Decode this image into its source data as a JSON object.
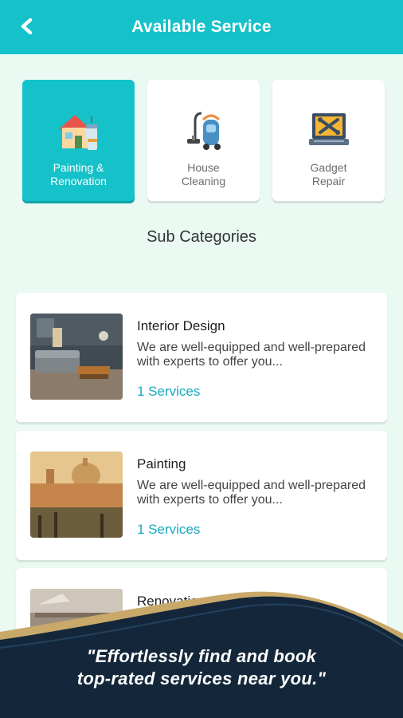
{
  "header": {
    "title": "Available Service",
    "back_icon": "chevron-left-icon"
  },
  "categories": [
    {
      "label": "Painting &\nRenovation",
      "icon": "paint-house-icon",
      "active": true
    },
    {
      "label": "House\nCleaning",
      "icon": "vacuum-cleaner-icon",
      "active": false
    },
    {
      "label": "Gadget\nRepair",
      "icon": "laptop-repair-icon",
      "active": false
    }
  ],
  "sub_categories": {
    "title": "Sub Categories",
    "items": [
      {
        "title": "Interior Design",
        "description": "We are well-equipped and well-prepared with experts to offer you...",
        "count": "1 Services"
      },
      {
        "title": "Painting",
        "description": "We are well-equipped and well-prepared with experts to offer you...",
        "count": "1 Services"
      },
      {
        "title": "Renovation",
        "description": "",
        "count": ""
      }
    ]
  },
  "promo": {
    "line1": "\"Effortlessly find and book",
    "line2": "top-rated services near you.\""
  },
  "colors": {
    "accent": "#15c2c9",
    "background": "#eafaf3",
    "footer_navy": "#14273a",
    "footer_gold": "#c9a96a"
  }
}
